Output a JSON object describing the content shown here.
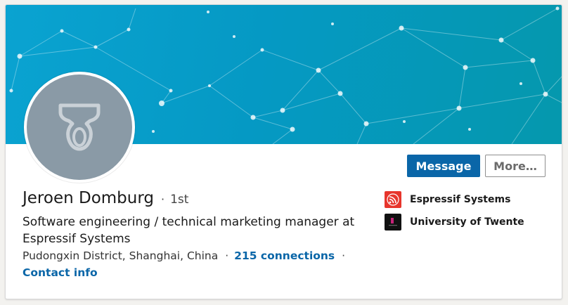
{
  "profile": {
    "name": "Jeroen Domburg",
    "name_separator": "·",
    "degree": "1st",
    "headline": "Software engineering / technical marketing manager at Espressif Systems",
    "location": "Pudongxin District, Shanghai, China",
    "location_separator": "·",
    "connections": "215 connections",
    "connections_separator": "·",
    "contact_info": "Contact info"
  },
  "actions": {
    "message_label": "Message",
    "more_label": "More…"
  },
  "organizations": [
    {
      "name": "Espressif Systems",
      "icon": "espressif-logo-icon",
      "color": "#e7352c"
    },
    {
      "name": "University of Twente",
      "icon": "university-of-twente-logo-icon",
      "color": "#111111"
    }
  ],
  "colors": {
    "accent": "#0a66a8",
    "banner_start": "#0aa3d1",
    "banner_end": "#0598ad",
    "avatar_bg": "#8a9aa6"
  }
}
